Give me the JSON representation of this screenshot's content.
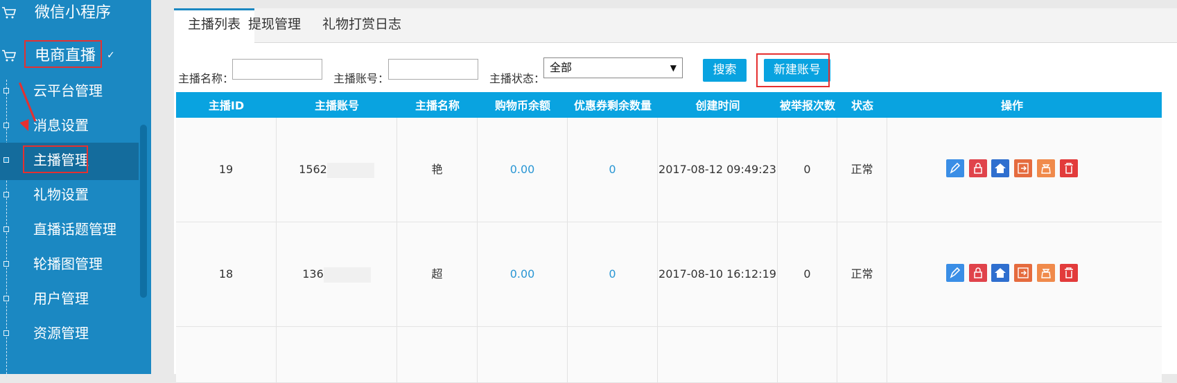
{
  "sidebar": {
    "group_top": "微信小程序",
    "group_active": "电商直播",
    "items": [
      {
        "label": "云平台管理"
      },
      {
        "label": "消息设置"
      },
      {
        "label": "主播管理"
      },
      {
        "label": "礼物设置"
      },
      {
        "label": "直播话题管理"
      },
      {
        "label": "轮播图管理"
      },
      {
        "label": "用户管理"
      },
      {
        "label": "资源管理"
      }
    ]
  },
  "tabs": [
    {
      "label": "主播列表"
    },
    {
      "label": "提现管理"
    },
    {
      "label": "礼物打赏日志"
    }
  ],
  "filters": {
    "name_label": "主播名称：",
    "account_label": "主播账号：",
    "status_label": "主播状态：",
    "status_value": "全部",
    "search_button": "搜索",
    "new_button": "新建账号"
  },
  "table": {
    "columns": [
      "主播ID",
      "主播账号",
      "主播名称",
      "购物币余额",
      "优惠券剩余数量",
      "创建时间",
      "被举报次数",
      "状态",
      "操作"
    ],
    "rows": [
      {
        "id": "19",
        "account": "1562",
        "name": "艳",
        "balance": "0.00",
        "coupons": "0",
        "created": "2017-08-12 09:49:23",
        "reports": "0",
        "status": "正常"
      },
      {
        "id": "18",
        "account": "136",
        "name": "超",
        "balance": "0.00",
        "coupons": "0",
        "created": "2017-08-10 16:12:19",
        "reports": "0",
        "status": "正常"
      }
    ]
  },
  "colors": {
    "accent": "#09a3e0",
    "sidebar": "#1b88c2",
    "highlight": "#e53030",
    "op_edit": "#3a8ee6",
    "op_lock": "#e0434b",
    "op_home": "#2f6fcf",
    "op_export": "#e56b3e",
    "op_money": "#f08a4b",
    "op_delete": "#e23b3b"
  },
  "icons": {
    "cart": "cart-icon",
    "edit": "edit-icon",
    "lock": "lock-icon",
    "home": "home-icon",
    "export": "export-icon",
    "money": "money-bag-icon",
    "delete": "trash-icon"
  }
}
